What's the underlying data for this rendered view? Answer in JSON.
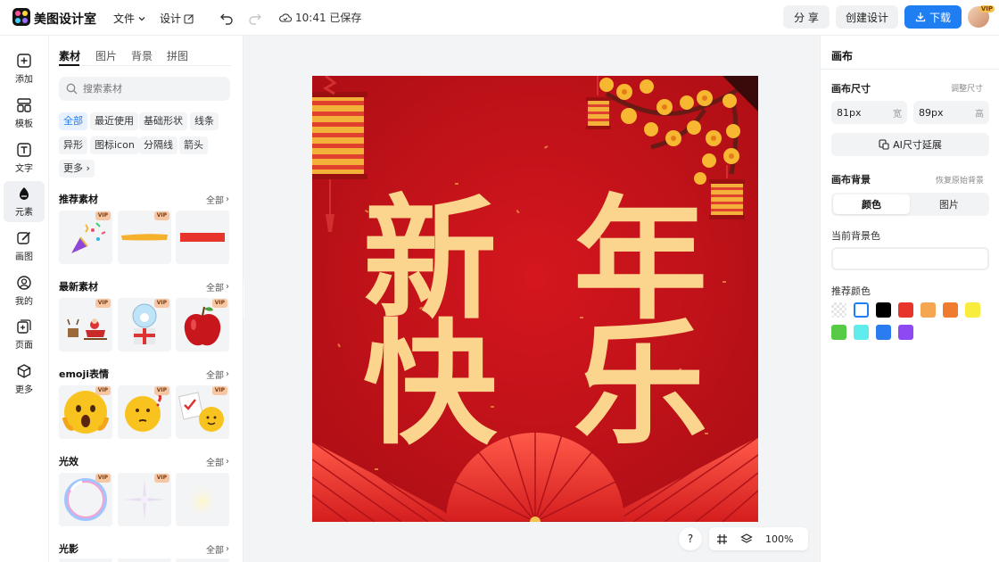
{
  "app": {
    "name": "美图设计室",
    "menu_file": "文件",
    "menu_design": "设计",
    "save_time": "10:41 已保存",
    "share_label": "分 享",
    "create_label": "创建设计",
    "download_label": "下载",
    "avatar_badge": "VIP"
  },
  "rail": [
    {
      "label": "添加",
      "icon": "plus-square-icon"
    },
    {
      "label": "模板",
      "icon": "template-icon"
    },
    {
      "label": "文字",
      "icon": "text-icon"
    },
    {
      "label": "元素",
      "icon": "shapes-icon"
    },
    {
      "label": "画图",
      "icon": "draw-icon"
    },
    {
      "label": "我的",
      "icon": "user-icon"
    },
    {
      "label": "页面",
      "icon": "page-add-icon"
    },
    {
      "label": "更多",
      "icon": "cube-icon"
    }
  ],
  "panel": {
    "tabs": [
      "素材",
      "图片",
      "背景",
      "拼图"
    ],
    "search_placeholder": "搜索素材",
    "filters": [
      "全部",
      "最近使用",
      "基础形状",
      "线条",
      "异形",
      "图标icon",
      "分隔线",
      "箭头",
      "更多"
    ],
    "all_label": "全部",
    "vip_label": "VIP",
    "sections": [
      {
        "title": "推荐素材",
        "items": [
          "confetti-popper",
          "yellow-brush-stroke",
          "red-bar"
        ]
      },
      {
        "title": "最新素材",
        "items": [
          "santa-sleigh",
          "snow-globe-gift",
          "red-apple"
        ]
      },
      {
        "title": "emoji表情",
        "items": [
          "shocked-emoji",
          "thinking-emoji",
          "checklist-emoji"
        ]
      },
      {
        "title": "光效",
        "items": [
          "bubble-ring",
          "sparkle-star",
          "soft-glow"
        ]
      },
      {
        "title": "光影",
        "items": []
      }
    ]
  },
  "poster": {
    "chars": [
      "新",
      "年",
      "快",
      "乐"
    ],
    "bg": "#c8101a",
    "text_color": "#fbd58d"
  },
  "toolbar": {
    "help": "?",
    "zoom": "100%"
  },
  "right": {
    "title": "画布",
    "size_label": "画布尺寸",
    "resize_link": "调整尺寸",
    "width_value": "81px",
    "width_unit": "宽",
    "height_value": "89px",
    "height_unit": "高",
    "ai_extend": "AI尺寸延展",
    "bg_label": "画布背景",
    "restore_link": "恢复原始背景",
    "seg_color": "颜色",
    "seg_image": "图片",
    "current_bg": "当前背景色",
    "recommend": "推荐颜色",
    "swatches": [
      "transparent",
      "#ffffff",
      "#000000",
      "#e8352b",
      "#f5a651",
      "#ef7b2f",
      "#f8ec3d",
      "#57cb45",
      "#5eeced",
      "#2b7cf0",
      "#8f49f2"
    ]
  }
}
